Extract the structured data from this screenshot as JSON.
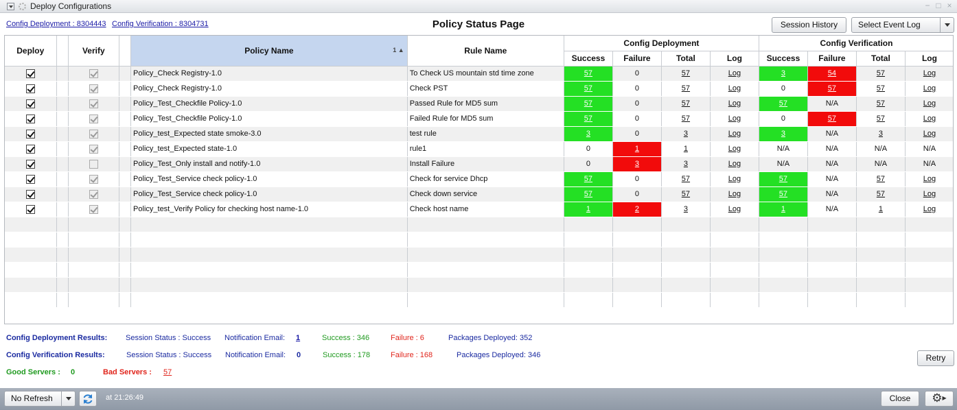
{
  "window": {
    "title": "Deploy Configurations"
  },
  "top_links": {
    "deployment": "Config Deployment : 8304443",
    "verification": "Config Verification : 8304731"
  },
  "page_title": "Policy Status Page",
  "buttons": {
    "session_history": "Session History",
    "select_event_log": "Select Event Log",
    "retry": "Retry",
    "close": "Close"
  },
  "table": {
    "headers": {
      "deploy": "Deploy",
      "verify": "Verify",
      "policy_name": "Policy Name",
      "rule_name": "Rule Name",
      "group_deploy": "Config Deployment",
      "group_verify": "Config Verification",
      "success": "Success",
      "failure": "Failure",
      "total": "Total",
      "log": "Log"
    },
    "sort_indicator": "1",
    "rows": [
      {
        "deploy": true,
        "verify": true,
        "verify_enabled": true,
        "policy": "Policy_Check Registry-1.0",
        "rule": "To Check US mountain std time zone",
        "d_success": "57",
        "d_failure": "0",
        "d_total": "57",
        "d_log": "Log",
        "v_success": "3",
        "v_failure": "54",
        "v_total": "57",
        "v_log": "Log"
      },
      {
        "deploy": true,
        "verify": true,
        "verify_enabled": true,
        "policy": "Policy_Check Registry-1.0",
        "rule": "Check PST",
        "d_success": "57",
        "d_failure": "0",
        "d_total": "57",
        "d_log": "Log",
        "v_success": "0",
        "v_failure": "57",
        "v_total": "57",
        "v_log": "Log"
      },
      {
        "deploy": true,
        "verify": true,
        "verify_enabled": true,
        "policy": "Policy_Test_Checkfile Policy-1.0",
        "rule": "Passed Rule for MD5 sum",
        "d_success": "57",
        "d_failure": "0",
        "d_total": "57",
        "d_log": "Log",
        "v_success": "57",
        "v_failure": "N/A",
        "v_total": "57",
        "v_log": "Log"
      },
      {
        "deploy": true,
        "verify": true,
        "verify_enabled": true,
        "policy": "Policy_Test_Checkfile Policy-1.0",
        "rule": "Failed Rule for MD5 sum",
        "d_success": "57",
        "d_failure": "0",
        "d_total": "57",
        "d_log": "Log",
        "v_success": "0",
        "v_failure": "57",
        "v_total": "57",
        "v_log": "Log"
      },
      {
        "deploy": true,
        "verify": true,
        "verify_enabled": true,
        "policy": "Policy_test_Expected state smoke-3.0",
        "rule": "test rule",
        "d_success": "3",
        "d_failure": "0",
        "d_total": "3",
        "d_log": "Log",
        "v_success": "3",
        "v_failure": "N/A",
        "v_total": "3",
        "v_log": "Log"
      },
      {
        "deploy": true,
        "verify": true,
        "verify_enabled": true,
        "policy": "Policy_test_Expected state-1.0",
        "rule": "rule1",
        "d_success": "0",
        "d_failure": "1",
        "d_total": "1",
        "d_log": "Log",
        "v_success": "N/A",
        "v_failure": "N/A",
        "v_total": "N/A",
        "v_log": "N/A"
      },
      {
        "deploy": true,
        "verify": false,
        "verify_enabled": true,
        "policy": "Policy_Test_Only install and notify-1.0",
        "rule": "Install Failure",
        "d_success": "0",
        "d_failure": "3",
        "d_total": "3",
        "d_log": "Log",
        "v_success": "N/A",
        "v_failure": "N/A",
        "v_total": "N/A",
        "v_log": "N/A"
      },
      {
        "deploy": true,
        "verify": true,
        "verify_enabled": true,
        "policy": "Policy_Test_Service check policy-1.0",
        "rule": "Check for service Dhcp",
        "d_success": "57",
        "d_failure": "0",
        "d_total": "57",
        "d_log": "Log",
        "v_success": "57",
        "v_failure": "N/A",
        "v_total": "57",
        "v_log": "Log"
      },
      {
        "deploy": true,
        "verify": true,
        "verify_enabled": true,
        "policy": "Policy_Test_Service check policy-1.0",
        "rule": "Check down service",
        "d_success": "57",
        "d_failure": "0",
        "d_total": "57",
        "d_log": "Log",
        "v_success": "57",
        "v_failure": "N/A",
        "v_total": "57",
        "v_log": "Log"
      },
      {
        "deploy": true,
        "verify": true,
        "verify_enabled": true,
        "policy": "Policy_test_Verify Policy for checking host name-1.0",
        "rule": "Check host name",
        "d_success": "1",
        "d_failure": "2",
        "d_total": "3",
        "d_log": "Log",
        "v_success": "1",
        "v_failure": "N/A",
        "v_total": "1",
        "v_log": "Log"
      }
    ]
  },
  "results": {
    "deploy": {
      "label": "Config Deployment Results:",
      "session_status": "Session Status : Success",
      "notif_label": "Notification Email:",
      "notif_value": "1",
      "success": "Success : 346",
      "failure": "Failure : 6",
      "packages": "Packages Deployed: 352"
    },
    "verify": {
      "label": "Config Verification Results:",
      "session_status": "Session Status : Success",
      "notif_label": "Notification Email:",
      "notif_value": "0",
      "success": "Success : 178",
      "failure": "Failure : 168",
      "packages": "Packages Deployed: 346"
    },
    "good_servers_label": "Good Servers :",
    "good_servers_value": "0",
    "bad_servers_label": "Bad Servers :",
    "bad_servers_value": "57"
  },
  "footer": {
    "refresh_option": "No Refresh",
    "timestamp": "at 21:26:49"
  },
  "colors": {
    "success": "#24e024",
    "failure": "#f20b0b",
    "footer": "#98a1ad",
    "link": "#1a1aa6"
  }
}
